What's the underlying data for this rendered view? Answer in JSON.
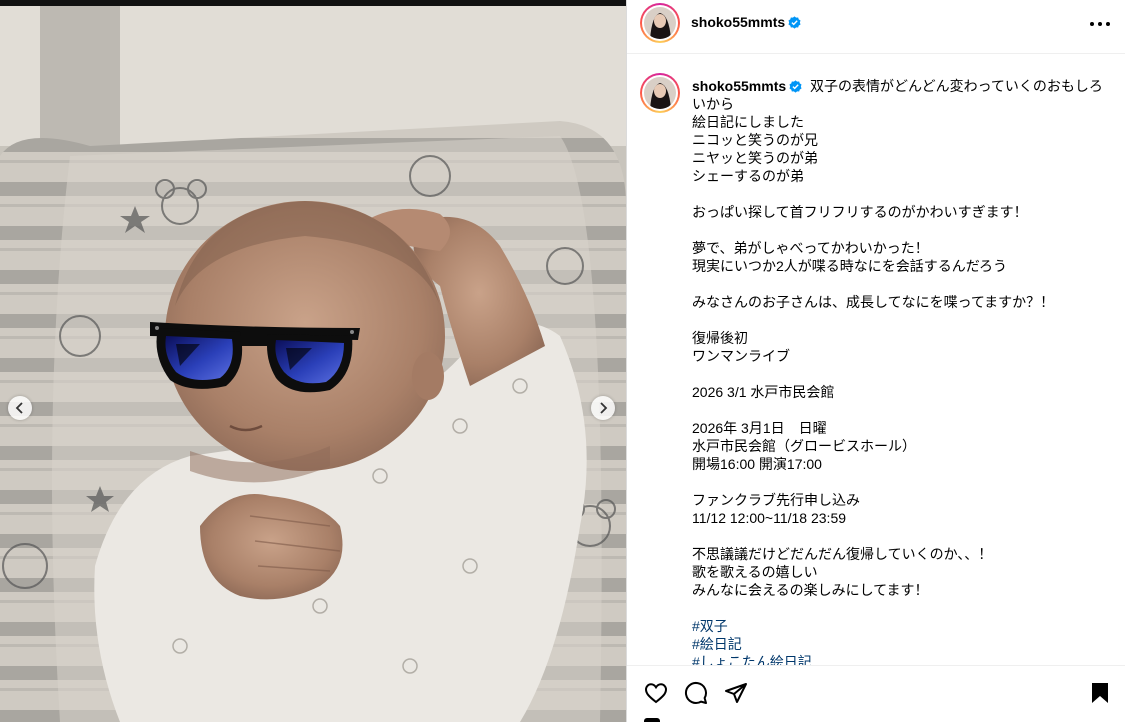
{
  "post": {
    "username": "shoko55mmts",
    "verified": true,
    "caption": {
      "first_line": "双子の表情がどんどん変わっていくのおもしろいから",
      "lines": [
        "絵日記にしました",
        "ニコッと笑うのが兄",
        "ニヤッと笑うのが弟",
        "シェーするのが弟",
        "",
        "おっぱい探して首フリフリするのがかわいすぎます！",
        "",
        "夢で、弟がしゃべってかわいかった！",
        "現実にいつか2人が喋る時なにを会話するんだろう",
        "",
        "みなさんのお子さんは、成長してなにを喋ってますか？！",
        "",
        "復帰後初",
        "ワンマンライブ",
        "",
        "2026 3/1 水戸市民会館",
        "",
        "2026年 3月1日　日曜",
        "水戸市民会館（グロービスホール）",
        "開場16:00 開演17:00",
        "",
        "ファンクラブ先行申し込み",
        "11/12 12:00~11/18 23:59",
        "",
        "不思議議だけどだんだん復帰していくのか、、！",
        "歌を歌えるの嬉しい",
        "みんなに会えるの楽しみにしてます！",
        ""
      ],
      "hashtags": [
        "#双子",
        "#絵日記",
        "#しょこたん絵日記"
      ]
    }
  },
  "icons": {
    "verified": "verified-badge-icon",
    "more": "more-options-icon",
    "prev": "chevron-left-icon",
    "next": "chevron-right-icon",
    "like": "heart-icon",
    "comment": "comment-icon",
    "share": "share-icon",
    "save": "bookmark-icon"
  },
  "colors": {
    "verified": "#0095f6",
    "hashtag": "#00376b",
    "text": "#000000"
  }
}
